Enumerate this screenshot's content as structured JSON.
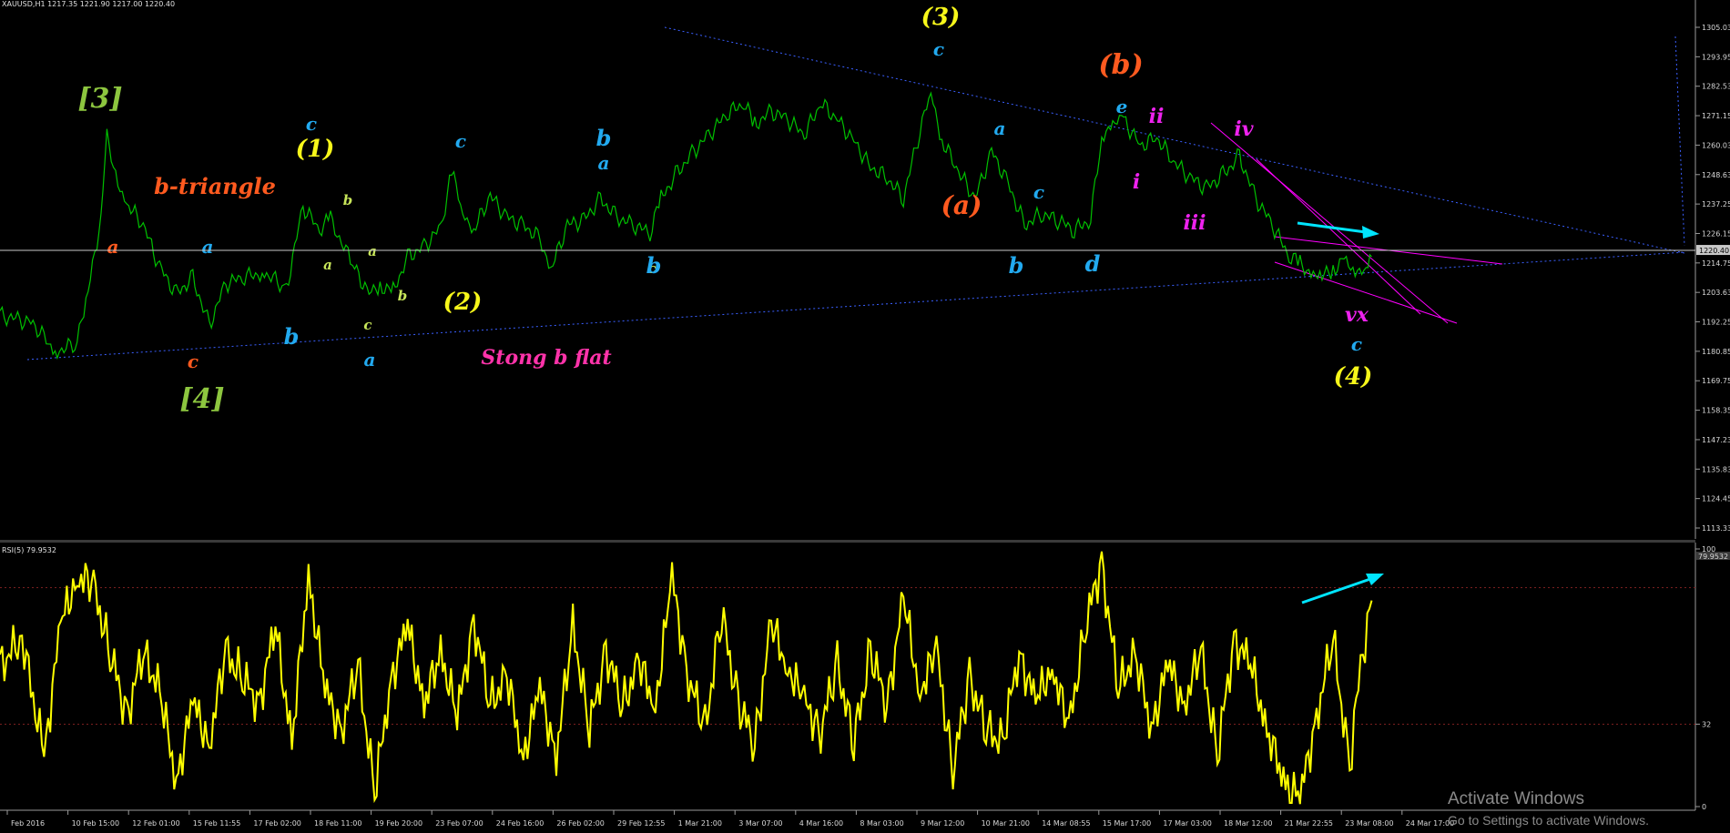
{
  "window": {
    "symbol_header": "XAUUSD,H1  1217.35 1221.90 1217.00 1220.40",
    "rsi_header": "RSI(5) 79.9532"
  },
  "watermark": {
    "line1": "Activate Windows",
    "line2": "Go to Settings to activate Windows."
  },
  "colors": {
    "background": "#000000",
    "price_line": "#00c000",
    "rsi_line": "#ffff00",
    "trendline": "#3a5fff",
    "channel": "#ff00ff",
    "arrow": "#00e5ff",
    "level_line": "#c8c8c8",
    "rsi_level": "#7a1f1f"
  },
  "chart_data": [
    {
      "type": "line",
      "name": "price",
      "ylim": [
        1113.3,
        1311.0
      ],
      "y_ticks": [
        "1305.03",
        "1293.95",
        "1282.53",
        "1271.15",
        "1260.03",
        "1248.63",
        "1237.25",
        "1226.15",
        "1214.75",
        "1203.63",
        "1192.25",
        "1180.85",
        "1169.75",
        "1158.35",
        "1147.23",
        "1135.83",
        "1124.45",
        "1113.33"
      ],
      "current_price": "1220.40",
      "x_labels": [
        "Feb 2016",
        "10 Feb 15:00",
        "12 Feb 01:00",
        "15 Feb 11:55",
        "17 Feb 02:00",
        "18 Feb 11:00",
        "19 Feb 20:00",
        "23 Feb 07:00",
        "24 Feb 16:00",
        "26 Feb 02:00",
        "29 Feb 12:55",
        "1 Mar 21:00",
        "3 Mar 07:00",
        "4 Mar 16:00",
        "8 Mar 03:00",
        "9 Mar 12:00",
        "10 Mar 21:00",
        "14 Mar 08:55",
        "15 Mar 17:00",
        "17 Mar 03:00",
        "18 Mar 12:00",
        "21 Mar 22:55",
        "23 Mar 08:00",
        "24 Mar 17:00"
      ],
      "x": [
        0,
        30,
        50,
        70,
        80,
        90,
        97,
        105,
        115,
        130,
        145,
        160,
        175,
        190,
        205,
        220,
        240,
        260,
        275,
        290,
        300,
        320,
        335,
        345,
        355,
        370,
        385,
        400,
        410,
        420,
        430,
        445,
        460,
        475,
        490,
        500,
        515,
        530,
        545,
        560,
        575,
        590,
        600,
        615,
        630,
        645,
        660,
        675,
        685,
        700,
        715,
        730,
        745,
        760,
        775,
        790,
        805,
        820,
        835,
        845,
        855,
        870,
        885,
        900,
        915,
        930,
        945,
        960,
        975,
        990,
        1000,
        1010,
        1020,
        1035,
        1050,
        1065,
        1080,
        1095,
        1110,
        1125,
        1140,
        1155,
        1170,
        1180,
        1190,
        1200,
        1210,
        1220,
        1230,
        1240,
        1245
      ],
      "values": [
        1196,
        1193,
        1182,
        1185,
        1208,
        1225,
        1263,
        1248,
        1238,
        1230,
        1214,
        1204,
        1210,
        1192,
        1208,
        1210,
        1212,
        1206,
        1237,
        1228,
        1232,
        1215,
        1204,
        1208,
        1203,
        1218,
        1222,
        1229,
        1250,
        1235,
        1228,
        1241,
        1233,
        1230,
        1225,
        1213,
        1230,
        1232,
        1240,
        1233,
        1230,
        1227,
        1240,
        1250,
        1258,
        1265,
        1272,
        1276,
        1268,
        1273,
        1270,
        1264,
        1276,
        1270,
        1262,
        1252,
        1248,
        1240,
        1266,
        1280,
        1262,
        1250,
        1240,
        1258,
        1246,
        1230,
        1234,
        1232,
        1228,
        1232,
        1264,
        1268,
        1270,
        1260,
        1263,
        1254,
        1248,
        1244,
        1249,
        1256,
        1240,
        1230,
        1218,
        1215,
        1212,
        1210,
        1214,
        1216,
        1212,
        1215,
        1218
      ]
    },
    {
      "type": "line",
      "name": "RSI(5)",
      "ylim": [
        0,
        100
      ],
      "y_ticks": [
        "100",
        "79.9532",
        "32",
        "0"
      ],
      "levels": [
        85,
        32
      ],
      "current_value": "79.9532",
      "x": [
        0,
        20,
        40,
        55,
        70,
        85,
        100,
        115,
        130,
        145,
        160,
        175,
        190,
        205,
        220,
        235,
        250,
        265,
        280,
        295,
        310,
        325,
        340,
        355,
        370,
        385,
        400,
        415,
        430,
        445,
        460,
        475,
        490,
        505,
        520,
        535,
        550,
        565,
        580,
        595,
        610,
        625,
        640,
        655,
        670,
        685,
        700,
        715,
        730,
        745,
        760,
        775,
        790,
        805,
        820,
        835,
        850,
        865,
        880,
        895,
        910,
        925,
        940,
        955,
        970,
        985,
        1000,
        1015,
        1030,
        1045,
        1060,
        1075,
        1090,
        1105,
        1120,
        1135,
        1150,
        1165,
        1180,
        1195,
        1210,
        1225,
        1235,
        1245
      ],
      "values": [
        55,
        65,
        20,
        70,
        90,
        85,
        60,
        35,
        60,
        45,
        10,
        40,
        25,
        60,
        50,
        40,
        70,
        25,
        90,
        45,
        30,
        55,
        5,
        50,
        70,
        40,
        60,
        35,
        72,
        40,
        50,
        20,
        45,
        20,
        70,
        30,
        60,
        40,
        55,
        40,
        88,
        50,
        30,
        75,
        40,
        25,
        70,
        55,
        40,
        30,
        55,
        25,
        60,
        40,
        80,
        45,
        60,
        15,
        50,
        30,
        25,
        60,
        40,
        55,
        30,
        70,
        95,
        45,
        60,
        30,
        55,
        40,
        60,
        20,
        65,
        55,
        30,
        10,
        3,
        35,
        65,
        15,
        55,
        80
      ]
    }
  ],
  "annotations": [
    {
      "text": "[3]",
      "color": "#8dc63f",
      "size": 30
    },
    {
      "text": "a",
      "color": "#ff5a1f",
      "size": 20
    },
    {
      "text": "b-triangle",
      "color": "#ff5a1f",
      "size": 24
    },
    {
      "text": "c",
      "color": "#ff5a1f",
      "size": 20
    },
    {
      "text": "[4]",
      "color": "#8dc63f",
      "size": 30
    },
    {
      "text": "a",
      "color": "#22aaf0",
      "size": 20
    },
    {
      "text": "b",
      "color": "#22aaf0",
      "size": 24
    },
    {
      "text": "c",
      "color": "#22aaf0",
      "size": 20
    },
    {
      "text": "(1)",
      "color": "#f7f71a",
      "size": 26
    },
    {
      "text": "b",
      "color": "#c8e65a",
      "size": 15
    },
    {
      "text": "a",
      "color": "#c8e65a",
      "size": 15
    },
    {
      "text": "a",
      "color": "#c8e65a",
      "size": 15
    },
    {
      "text": "c",
      "color": "#c8e65a",
      "size": 15
    },
    {
      "text": "b",
      "color": "#c8e65a",
      "size": 15
    },
    {
      "text": "a",
      "color": "#22aaf0",
      "size": 20
    },
    {
      "text": "b",
      "color": "#22aaf0",
      "size": 24
    },
    {
      "text": "c",
      "color": "#c8e65a",
      "size": 15
    },
    {
      "text": "c",
      "color": "#22aaf0",
      "size": 20
    },
    {
      "text": "(2)",
      "color": "#f7f71a",
      "size": 26
    },
    {
      "text": "Stong b flat",
      "color": "#ff33aa",
      "size": 22
    },
    {
      "text": "a",
      "color": "#22aaf0",
      "size": 20
    },
    {
      "text": "b",
      "color": "#22aaf0",
      "size": 24
    },
    {
      "text": "(3)",
      "color": "#f7f71a",
      "size": 26
    },
    {
      "text": "c",
      "color": "#22aaf0",
      "size": 20
    },
    {
      "text": "a",
      "color": "#22aaf0",
      "size": 20
    },
    {
      "text": "(a)",
      "color": "#ff5a1f",
      "size": 28
    },
    {
      "text": "c",
      "color": "#22aaf0",
      "size": 20
    },
    {
      "text": "b",
      "color": "#22aaf0",
      "size": 24
    },
    {
      "text": "d",
      "color": "#22aaf0",
      "size": 24
    },
    {
      "text": "(b)",
      "color": "#ff5a1f",
      "size": 30
    },
    {
      "text": "e",
      "color": "#22aaf0",
      "size": 20
    },
    {
      "text": "ii",
      "color": "#ee22ee",
      "size": 22
    },
    {
      "text": "i",
      "color": "#ee22ee",
      "size": 22
    },
    {
      "text": "iii",
      "color": "#ee22ee",
      "size": 22
    },
    {
      "text": "iv",
      "color": "#ee22ee",
      "size": 22
    },
    {
      "text": "vx",
      "color": "#ee22ee",
      "size": 22
    },
    {
      "text": "c",
      "color": "#22aaf0",
      "size": 20
    },
    {
      "text": "(4)",
      "color": "#f7f71a",
      "size": 26
    }
  ]
}
